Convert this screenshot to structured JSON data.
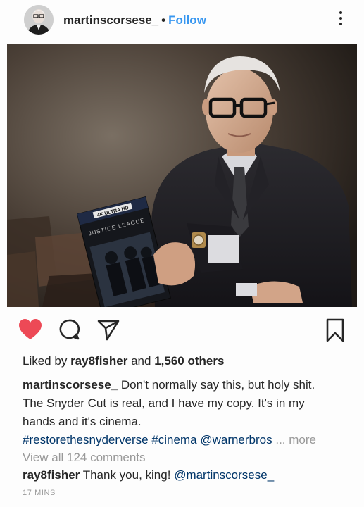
{
  "post": {
    "username": "martinscorsese_",
    "separator": "•",
    "follow_label": "Follow",
    "image": {
      "dvd_tag": "4K ULTRA HD",
      "dvd_title": "JUSTICE LEAGUE"
    },
    "likes": {
      "prefix": "Liked by",
      "liker": "ray8fisher",
      "conj": "and",
      "others": "1,560 others"
    },
    "caption": {
      "user": "martinscorsese_",
      "line1": "Don't normally say this, but holy shit.",
      "line2": "The Snyder Cut is real, and I have my copy. It's in my",
      "line3": "hands and it's cinema.",
      "tag1": "#restorethesnyderverse",
      "tag2": "#cinema",
      "tag3": "@warnerbros",
      "more": "... more"
    },
    "view_all_comments": "View all 124 comments",
    "comment": {
      "user": "ray8fisher",
      "text": "Thank you, king!",
      "mention": "@martinscorsese_"
    },
    "timestamp": "17 MINS"
  },
  "icons": [
    "heart-icon",
    "comment-icon",
    "share-icon",
    "bookmark-icon",
    "more-options-icon"
  ],
  "colors": {
    "like_red": "#ed4956",
    "link_blue": "#3897f0",
    "hashtag": "#003569",
    "muted": "#999999"
  }
}
